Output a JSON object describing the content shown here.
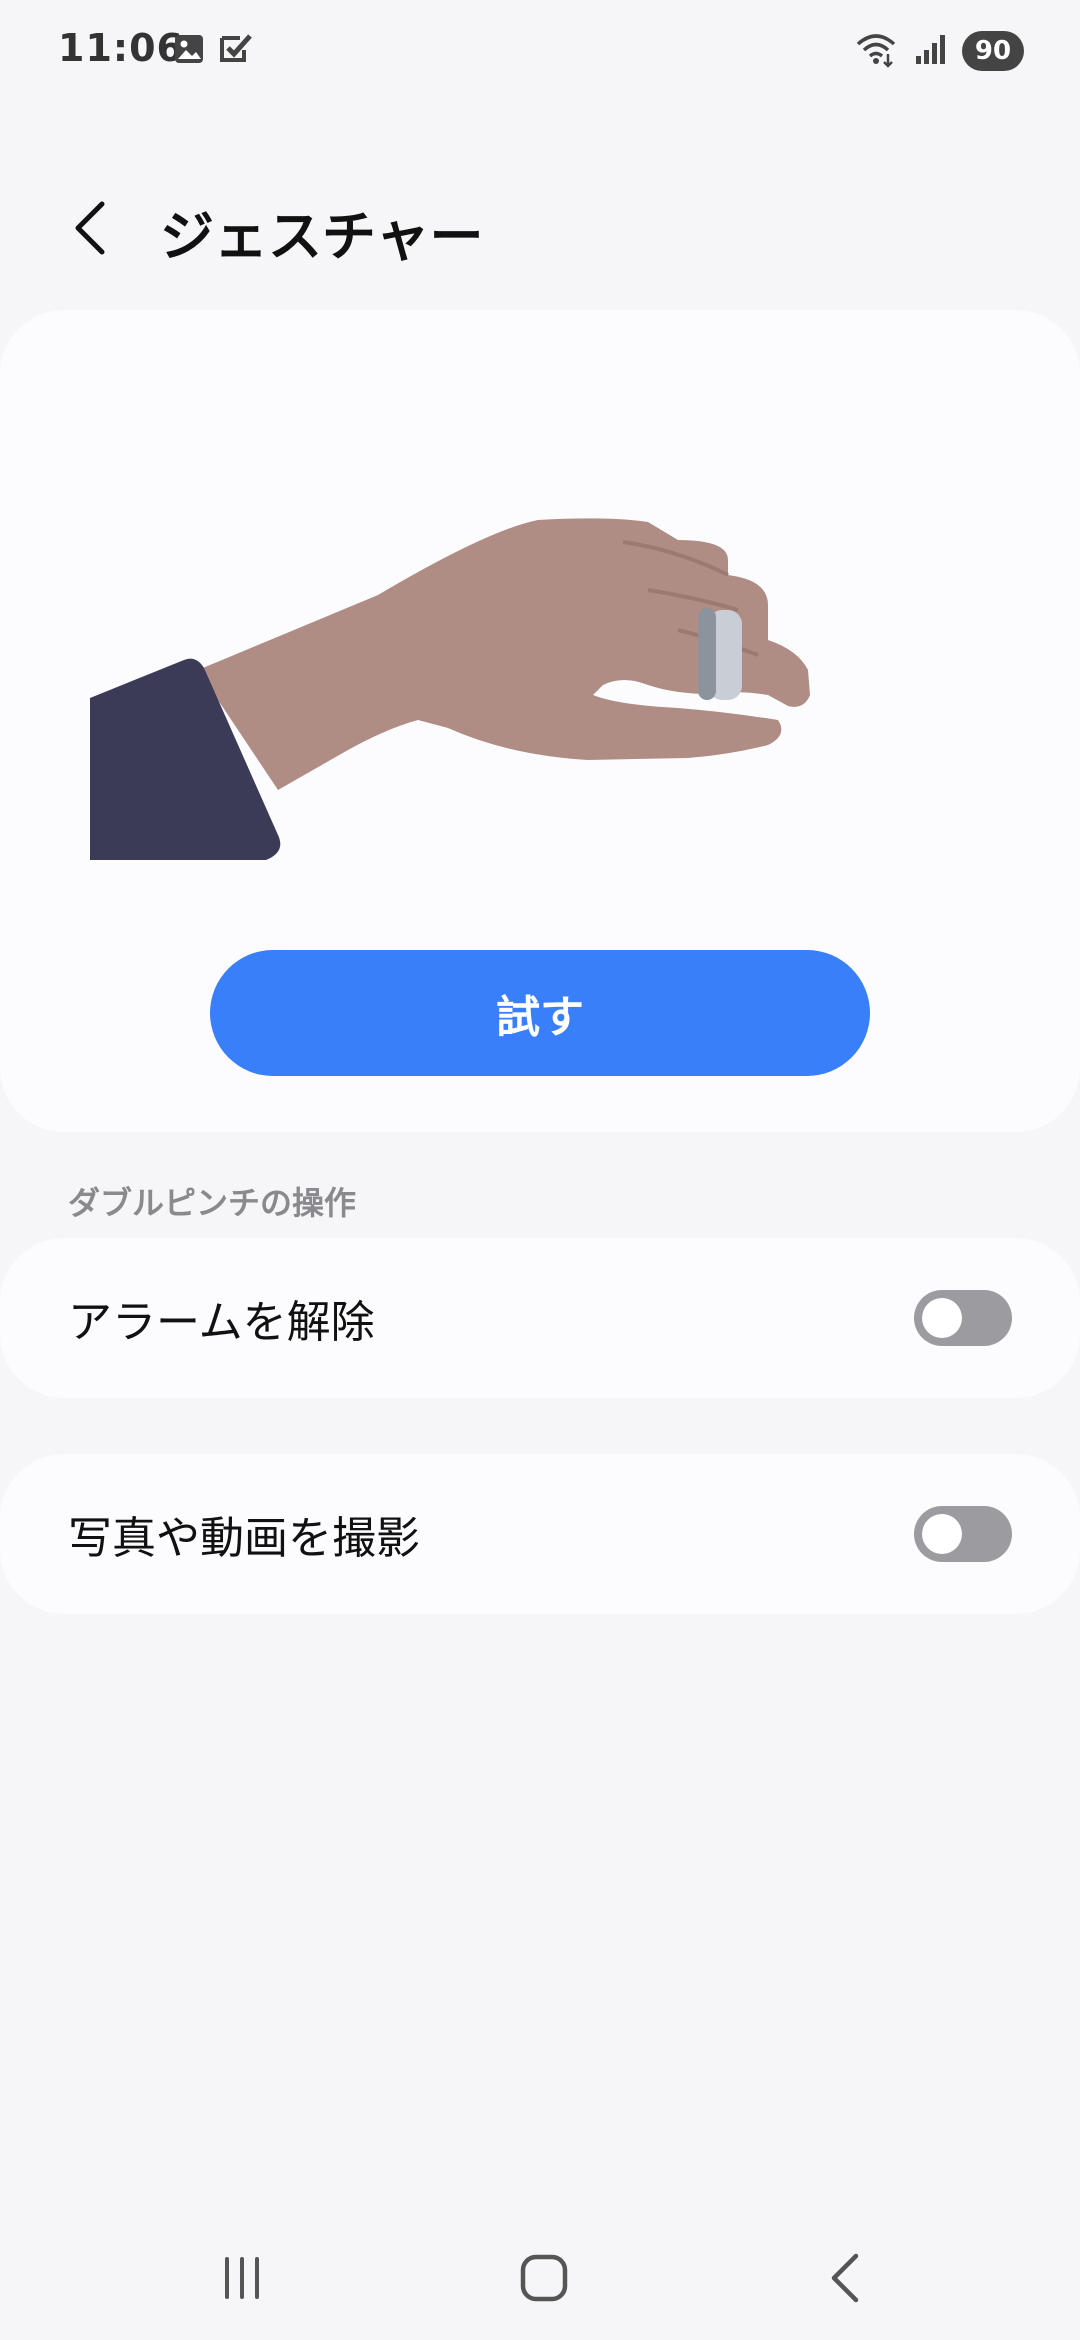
{
  "status_bar": {
    "time": "11:06",
    "battery": "90",
    "icons": [
      "image-icon",
      "check-task-icon",
      "wifi-icon",
      "signal-icon"
    ]
  },
  "header": {
    "title": "ジェスチャー",
    "back_icon": "chevron-left-icon"
  },
  "hero": {
    "try_button_label": "試す",
    "illustration": "hand-with-ring-pinch"
  },
  "section": {
    "label": "ダブルピンチの操作"
  },
  "settings": [
    {
      "label": "アラームを解除",
      "enabled": false
    },
    {
      "label": "写真や動画を撮影",
      "enabled": false
    }
  ],
  "nav_bar": {
    "icons": [
      "recents-icon",
      "home-icon",
      "back-icon"
    ]
  },
  "colors": {
    "accent": "#3a7ffa",
    "background": "#f6f6f8",
    "card": "#fcfcfe",
    "toggle_off": "#9c9ca0",
    "skin": "#b08d84",
    "sleeve": "#3b3a57"
  }
}
